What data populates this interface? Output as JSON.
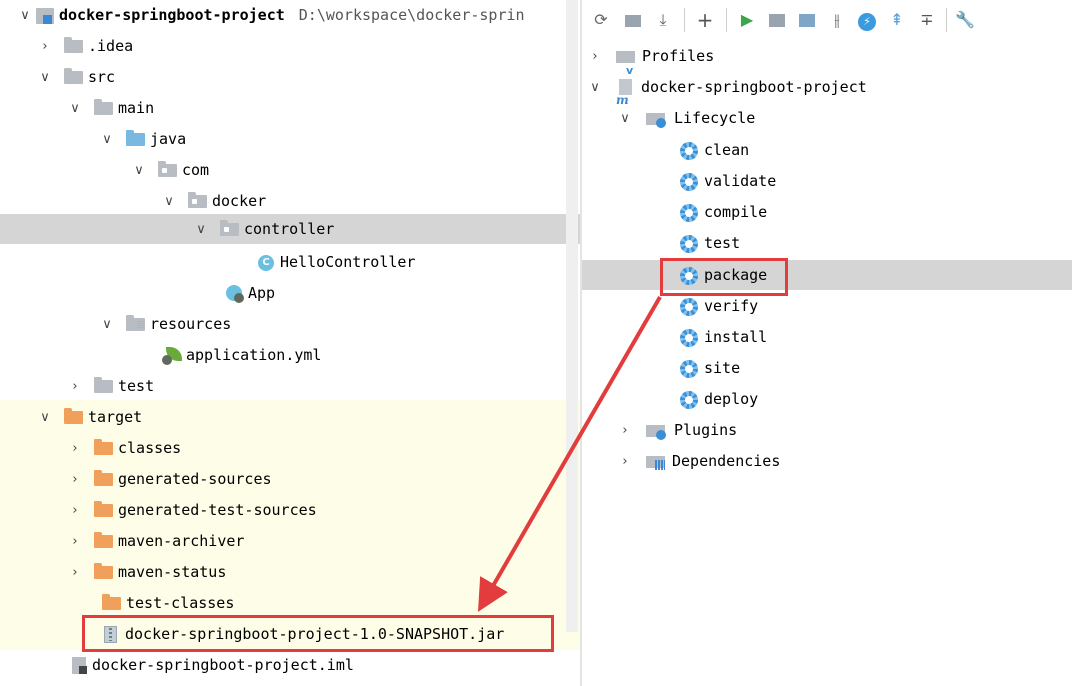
{
  "project_tree": {
    "root": {
      "name": "docker-springboot-project",
      "path": "D:\\workspace\\docker-sprin"
    },
    "idea": ".idea",
    "src": "src",
    "main": "main",
    "java": "java",
    "com": "com",
    "docker": "docker",
    "controller": "controller",
    "hello_controller": "HelloController",
    "app": "App",
    "resources": "resources",
    "application_yml": "application.yml",
    "test": "test",
    "target": "target",
    "classes": "classes",
    "generated_sources": "generated-sources",
    "generated_test_sources": "generated-test-sources",
    "maven_archiver": "maven-archiver",
    "maven_status": "maven-status",
    "test_classes": "test-classes",
    "jar": "docker-springboot-project-1.0-SNAPSHOT.jar",
    "iml": "docker-springboot-project.iml",
    "class_badge": "C"
  },
  "maven_panel": {
    "toolbar_icons": [
      "refresh-icon",
      "reimport-icon",
      "download-icon",
      "add-icon",
      "run-icon",
      "execute-goal-icon",
      "toggle-offline-icon",
      "skip-tests-icon",
      "lightning-icon",
      "expand-all-icon",
      "collapse-all-icon",
      "wrench-icon"
    ],
    "profiles": "Profiles",
    "project": "docker-springboot-project",
    "lifecycle": "Lifecycle",
    "goals": [
      "clean",
      "validate",
      "compile",
      "test",
      "package",
      "verify",
      "install",
      "site",
      "deploy"
    ],
    "plugins": "Plugins",
    "dependencies": "Dependencies",
    "maven_badge": "m",
    "profile_badge": "v"
  },
  "annotation": {
    "color": "#e23c3c"
  }
}
